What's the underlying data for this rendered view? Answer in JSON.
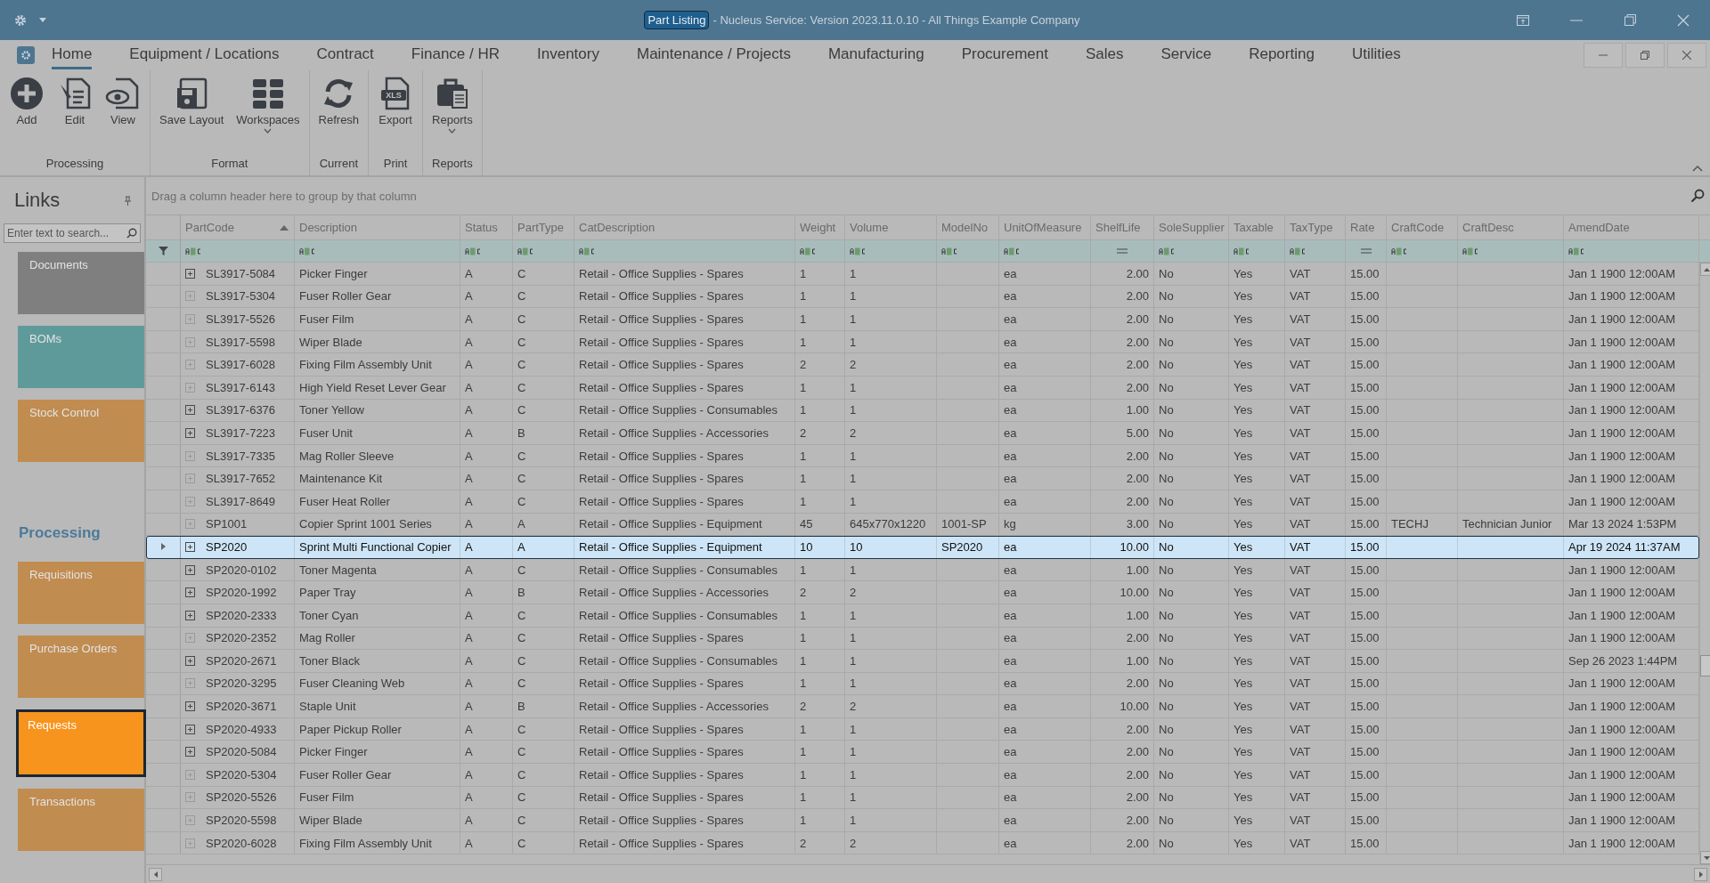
{
  "window": {
    "document_title": "Part Listing",
    "app_title": "- Nucleus Service: Version 2023.11.0.10 - All Things Example Company"
  },
  "ribbon_tabs": [
    {
      "label": "Home",
      "selected": true
    },
    {
      "label": "Equipment / Locations",
      "selected": false
    },
    {
      "label": "Contract",
      "selected": false
    },
    {
      "label": "Finance / HR",
      "selected": false
    },
    {
      "label": "Inventory",
      "selected": false
    },
    {
      "label": "Maintenance / Projects",
      "selected": false
    },
    {
      "label": "Manufacturing",
      "selected": false
    },
    {
      "label": "Procurement",
      "selected": false
    },
    {
      "label": "Sales",
      "selected": false
    },
    {
      "label": "Service",
      "selected": false
    },
    {
      "label": "Reporting",
      "selected": false
    },
    {
      "label": "Utilities",
      "selected": false
    }
  ],
  "ribbon_groups": [
    {
      "label": "Processing",
      "buttons": [
        {
          "label": "Add",
          "dropdown": false
        },
        {
          "label": "Edit",
          "dropdown": false
        },
        {
          "label": "View",
          "dropdown": false
        }
      ]
    },
    {
      "label": "Format",
      "buttons": [
        {
          "label": "Save Layout",
          "dropdown": false
        },
        {
          "label": "Workspaces",
          "dropdown": true
        }
      ]
    },
    {
      "label": "Current",
      "buttons": [
        {
          "label": "Refresh",
          "dropdown": false
        }
      ]
    },
    {
      "label": "Print",
      "buttons": [
        {
          "label": "Export",
          "icon_text": "XLS",
          "dropdown": false
        }
      ]
    },
    {
      "label": "Reports",
      "buttons": [
        {
          "label": "Reports",
          "dropdown": true
        }
      ]
    }
  ],
  "sidebar": {
    "title": "Links",
    "search_placeholder": "Enter text to search...",
    "sections": [
      {
        "tiles": [
          {
            "label": "Documents",
            "color": "#7f7f7f",
            "selected": false
          },
          {
            "label": "BOMs",
            "color": "#5f9a9b",
            "selected": false
          },
          {
            "label": "Stock Control",
            "color": "#c18c50",
            "selected": false
          }
        ]
      },
      {
        "heading": "Processing",
        "tiles": [
          {
            "label": "Requisitions",
            "color": "#c18c50",
            "selected": false
          },
          {
            "label": "Purchase Orders",
            "color": "#c18c50",
            "selected": false
          },
          {
            "label": "Requests",
            "color": "#f7941d",
            "selected": true
          },
          {
            "label": "Transactions",
            "color": "#c18c50",
            "selected": false
          }
        ]
      }
    ]
  },
  "grid": {
    "group_panel_hint": "Drag a column header here to group by that column",
    "columns": [
      {
        "label": "PartCode",
        "sorted_ascending": true,
        "numeric_filter": false
      },
      {
        "label": "Description",
        "sorted_ascending": false,
        "numeric_filter": false
      },
      {
        "label": "Status",
        "sorted_ascending": false,
        "numeric_filter": false
      },
      {
        "label": "PartType",
        "sorted_ascending": false,
        "numeric_filter": false
      },
      {
        "label": "CatDescription",
        "sorted_ascending": false,
        "numeric_filter": false
      },
      {
        "label": "Weight",
        "sorted_ascending": false,
        "numeric_filter": false
      },
      {
        "label": "Volume",
        "sorted_ascending": false,
        "numeric_filter": false
      },
      {
        "label": "ModelNo",
        "sorted_ascending": false,
        "numeric_filter": false
      },
      {
        "label": "UnitOfMeasure",
        "sorted_ascending": false,
        "numeric_filter": false
      },
      {
        "label": "ShelfLife",
        "sorted_ascending": false,
        "numeric_filter": true
      },
      {
        "label": "SoleSupplier",
        "sorted_ascending": false,
        "numeric_filter": false
      },
      {
        "label": "Taxable",
        "sorted_ascending": false,
        "numeric_filter": false
      },
      {
        "label": "TaxType",
        "sorted_ascending": false,
        "numeric_filter": false
      },
      {
        "label": "Rate",
        "sorted_ascending": false,
        "numeric_filter": true
      },
      {
        "label": "CraftCode",
        "sorted_ascending": false,
        "numeric_filter": false
      },
      {
        "label": "CraftDesc",
        "sorted_ascending": false,
        "numeric_filter": false
      },
      {
        "label": "AmendDate",
        "sorted_ascending": false,
        "numeric_filter": false
      }
    ],
    "rows": [
      {
        "selected": false,
        "has_children": true,
        "code": "SL3917-5084",
        "desc": "Picker Finger",
        "status": "A",
        "type": "C",
        "cat": "Retail - Office Supplies - Spares",
        "weight": "1",
        "volume": "1",
        "uom": "ea",
        "shelf": "2.00",
        "sole": "No",
        "taxable": "Yes",
        "taxtype": "VAT",
        "rate": "15.00",
        "amend": "Jan  1 1900 12:00AM"
      },
      {
        "selected": false,
        "has_children": false,
        "code": "SL3917-5304",
        "desc": "Fuser Roller Gear",
        "status": "A",
        "type": "C",
        "cat": "Retail - Office Supplies - Spares",
        "weight": "1",
        "volume": "1",
        "uom": "ea",
        "shelf": "2.00",
        "sole": "No",
        "taxable": "Yes",
        "taxtype": "VAT",
        "rate": "15.00",
        "amend": "Jan  1 1900 12:00AM"
      },
      {
        "selected": false,
        "has_children": false,
        "code": "SL3917-5526",
        "desc": "Fuser Film",
        "status": "A",
        "type": "C",
        "cat": "Retail - Office Supplies - Spares",
        "weight": "1",
        "volume": "1",
        "uom": "ea",
        "shelf": "2.00",
        "sole": "No",
        "taxable": "Yes",
        "taxtype": "VAT",
        "rate": "15.00",
        "amend": "Jan  1 1900 12:00AM"
      },
      {
        "selected": false,
        "has_children": false,
        "code": "SL3917-5598",
        "desc": "Wiper Blade",
        "status": "A",
        "type": "C",
        "cat": "Retail - Office Supplies - Spares",
        "weight": "1",
        "volume": "1",
        "uom": "ea",
        "shelf": "2.00",
        "sole": "No",
        "taxable": "Yes",
        "taxtype": "VAT",
        "rate": "15.00",
        "amend": "Jan  1 1900 12:00AM"
      },
      {
        "selected": false,
        "has_children": false,
        "code": "SL3917-6028",
        "desc": "Fixing Film Assembly Unit",
        "status": "A",
        "type": "C",
        "cat": "Retail - Office Supplies - Spares",
        "weight": "2",
        "volume": "2",
        "uom": "ea",
        "shelf": "2.00",
        "sole": "No",
        "taxable": "Yes",
        "taxtype": "VAT",
        "rate": "15.00",
        "amend": "Jan  1 1900 12:00AM"
      },
      {
        "selected": false,
        "has_children": false,
        "code": "SL3917-6143",
        "desc": "High Yield Reset Lever Gear",
        "status": "A",
        "type": "C",
        "cat": "Retail - Office Supplies - Spares",
        "weight": "1",
        "volume": "1",
        "uom": "ea",
        "shelf": "2.00",
        "sole": "No",
        "taxable": "Yes",
        "taxtype": "VAT",
        "rate": "15.00",
        "amend": "Jan  1 1900 12:00AM"
      },
      {
        "selected": false,
        "has_children": true,
        "code": "SL3917-6376",
        "desc": "Toner Yellow",
        "status": "A",
        "type": "C",
        "cat": "Retail - Office Supplies - Consumables",
        "weight": "1",
        "volume": "1",
        "uom": "ea",
        "shelf": "1.00",
        "sole": "No",
        "taxable": "Yes",
        "taxtype": "VAT",
        "rate": "15.00",
        "amend": "Jan  1 1900 12:00AM"
      },
      {
        "selected": false,
        "has_children": true,
        "code": "SL3917-7223",
        "desc": "Fuser Unit",
        "status": "A",
        "type": "B",
        "cat": "Retail - Office Supplies - Accessories",
        "weight": "2",
        "volume": "2",
        "uom": "ea",
        "shelf": "5.00",
        "sole": "No",
        "taxable": "Yes",
        "taxtype": "VAT",
        "rate": "15.00",
        "amend": "Jan  1 1900 12:00AM"
      },
      {
        "selected": false,
        "has_children": false,
        "code": "SL3917-7335",
        "desc": "Mag Roller Sleeve",
        "status": "A",
        "type": "C",
        "cat": "Retail - Office Supplies - Spares",
        "weight": "1",
        "volume": "1",
        "uom": "ea",
        "shelf": "2.00",
        "sole": "No",
        "taxable": "Yes",
        "taxtype": "VAT",
        "rate": "15.00",
        "amend": "Jan  1 1900 12:00AM"
      },
      {
        "selected": false,
        "has_children": false,
        "code": "SL3917-7652",
        "desc": "Maintenance Kit",
        "status": "A",
        "type": "C",
        "cat": "Retail - Office Supplies - Spares",
        "weight": "1",
        "volume": "1",
        "uom": "ea",
        "shelf": "2.00",
        "sole": "No",
        "taxable": "Yes",
        "taxtype": "VAT",
        "rate": "15.00",
        "amend": "Jan  1 1900 12:00AM"
      },
      {
        "selected": false,
        "has_children": false,
        "code": "SL3917-8649",
        "desc": "Fuser Heat Roller",
        "status": "A",
        "type": "C",
        "cat": "Retail - Office Supplies - Spares",
        "weight": "1",
        "volume": "1",
        "uom": "ea",
        "shelf": "2.00",
        "sole": "No",
        "taxable": "Yes",
        "taxtype": "VAT",
        "rate": "15.00",
        "amend": "Jan  1 1900 12:00AM"
      },
      {
        "selected": false,
        "has_children": false,
        "code": "SP1001",
        "desc": "Copier Sprint 1001 Series",
        "status": "A",
        "type": "A",
        "cat": "Retail - Office Supplies - Equipment",
        "weight": "45",
        "volume": "645x770x1220",
        "model": "1001-SP",
        "uom": "kg",
        "shelf": "3.00",
        "sole": "No",
        "taxable": "Yes",
        "taxtype": "VAT",
        "rate": "15.00",
        "craft": "TECHJ",
        "craftdesc": "Technician Junior",
        "amend": "Mar 13 2024  1:53PM"
      },
      {
        "selected": true,
        "has_children": true,
        "code": "SP2020",
        "desc": "Sprint Multi Functional Copier",
        "status": "A",
        "type": "A",
        "cat": "Retail - Office Supplies - Equipment",
        "weight": "10",
        "volume": "10",
        "model": "SP2020",
        "uom": "ea",
        "shelf": "10.00",
        "sole": "No",
        "taxable": "Yes",
        "taxtype": "VAT",
        "rate": "15.00",
        "amend": "Apr 19 2024 11:37AM"
      },
      {
        "selected": false,
        "has_children": true,
        "code": "SP2020-0102",
        "desc": "Toner Magenta",
        "status": "A",
        "type": "C",
        "cat": "Retail - Office Supplies - Consumables",
        "weight": "1",
        "volume": "1",
        "uom": "ea",
        "shelf": "1.00",
        "sole": "No",
        "taxable": "Yes",
        "taxtype": "VAT",
        "rate": "15.00",
        "amend": "Jan  1 1900 12:00AM"
      },
      {
        "selected": false,
        "has_children": true,
        "code": "SP2020-1992",
        "desc": "Paper Tray",
        "status": "A",
        "type": "B",
        "cat": "Retail - Office Supplies - Accessories",
        "weight": "2",
        "volume": "2",
        "uom": "ea",
        "shelf": "10.00",
        "sole": "No",
        "taxable": "Yes",
        "taxtype": "VAT",
        "rate": "15.00",
        "amend": "Jan  1 1900 12:00AM"
      },
      {
        "selected": false,
        "has_children": true,
        "code": "SP2020-2333",
        "desc": "Toner Cyan",
        "status": "A",
        "type": "C",
        "cat": "Retail - Office Supplies - Consumables",
        "weight": "1",
        "volume": "1",
        "uom": "ea",
        "shelf": "1.00",
        "sole": "No",
        "taxable": "Yes",
        "taxtype": "VAT",
        "rate": "15.00",
        "amend": "Jan  1 1900 12:00AM"
      },
      {
        "selected": false,
        "has_children": false,
        "code": "SP2020-2352",
        "desc": "Mag Roller",
        "status": "A",
        "type": "C",
        "cat": "Retail - Office Supplies - Spares",
        "weight": "1",
        "volume": "1",
        "uom": "ea",
        "shelf": "2.00",
        "sole": "No",
        "taxable": "Yes",
        "taxtype": "VAT",
        "rate": "15.00",
        "amend": "Jan  1 1900 12:00AM"
      },
      {
        "selected": false,
        "has_children": true,
        "code": "SP2020-2671",
        "desc": "Toner Black",
        "status": "A",
        "type": "C",
        "cat": "Retail - Office Supplies - Consumables",
        "weight": "1",
        "volume": "1",
        "uom": "ea",
        "shelf": "1.00",
        "sole": "No",
        "taxable": "Yes",
        "taxtype": "VAT",
        "rate": "15.00",
        "amend": "Sep 26 2023  1:44PM"
      },
      {
        "selected": false,
        "has_children": false,
        "code": "SP2020-3295",
        "desc": "Fuser Cleaning Web",
        "status": "A",
        "type": "C",
        "cat": "Retail - Office Supplies - Spares",
        "weight": "1",
        "volume": "1",
        "uom": "ea",
        "shelf": "2.00",
        "sole": "No",
        "taxable": "Yes",
        "taxtype": "VAT",
        "rate": "15.00",
        "amend": "Jan  1 1900 12:00AM"
      },
      {
        "selected": false,
        "has_children": true,
        "code": "SP2020-3671",
        "desc": "Staple Unit",
        "status": "A",
        "type": "B",
        "cat": "Retail - Office Supplies - Accessories",
        "weight": "2",
        "volume": "2",
        "uom": "ea",
        "shelf": "10.00",
        "sole": "No",
        "taxable": "Yes",
        "taxtype": "VAT",
        "rate": "15.00",
        "amend": "Jan  1 1900 12:00AM"
      },
      {
        "selected": false,
        "has_children": true,
        "code": "SP2020-4933",
        "desc": "Paper Pickup Roller",
        "status": "A",
        "type": "C",
        "cat": "Retail - Office Supplies - Spares",
        "weight": "1",
        "volume": "1",
        "uom": "ea",
        "shelf": "2.00",
        "sole": "No",
        "taxable": "Yes",
        "taxtype": "VAT",
        "rate": "15.00",
        "amend": "Jan  1 1900 12:00AM"
      },
      {
        "selected": false,
        "has_children": true,
        "code": "SP2020-5084",
        "desc": "Picker Finger",
        "status": "A",
        "type": "C",
        "cat": "Retail - Office Supplies - Spares",
        "weight": "1",
        "volume": "1",
        "uom": "ea",
        "shelf": "2.00",
        "sole": "No",
        "taxable": "Yes",
        "taxtype": "VAT",
        "rate": "15.00",
        "amend": "Jan  1 1900 12:00AM"
      },
      {
        "selected": false,
        "has_children": false,
        "code": "SP2020-5304",
        "desc": "Fuser Roller Gear",
        "status": "A",
        "type": "C",
        "cat": "Retail - Office Supplies - Spares",
        "weight": "1",
        "volume": "1",
        "uom": "ea",
        "shelf": "2.00",
        "sole": "No",
        "taxable": "Yes",
        "taxtype": "VAT",
        "rate": "15.00",
        "amend": "Jan  1 1900 12:00AM"
      },
      {
        "selected": false,
        "has_children": false,
        "code": "SP2020-5526",
        "desc": "Fuser Film",
        "status": "A",
        "type": "C",
        "cat": "Retail - Office Supplies - Spares",
        "weight": "1",
        "volume": "1",
        "uom": "ea",
        "shelf": "2.00",
        "sole": "No",
        "taxable": "Yes",
        "taxtype": "VAT",
        "rate": "15.00",
        "amend": "Jan  1 1900 12:00AM"
      },
      {
        "selected": false,
        "has_children": false,
        "code": "SP2020-5598",
        "desc": "Wiper Blade",
        "status": "A",
        "type": "C",
        "cat": "Retail - Office Supplies - Spares",
        "weight": "1",
        "volume": "1",
        "uom": "ea",
        "shelf": "2.00",
        "sole": "No",
        "taxable": "Yes",
        "taxtype": "VAT",
        "rate": "15.00",
        "amend": "Jan  1 1900 12:00AM"
      },
      {
        "selected": false,
        "has_children": false,
        "code": "SP2020-6028",
        "desc": "Fixing Film Assembly Unit",
        "status": "A",
        "type": "C",
        "cat": "Retail - Office Supplies - Spares",
        "weight": "2",
        "volume": "2",
        "uom": "ea",
        "shelf": "2.00",
        "sole": "No",
        "taxable": "Yes",
        "taxtype": "VAT",
        "rate": "15.00",
        "amend": "Jan  1 1900 12:00AM"
      }
    ]
  }
}
